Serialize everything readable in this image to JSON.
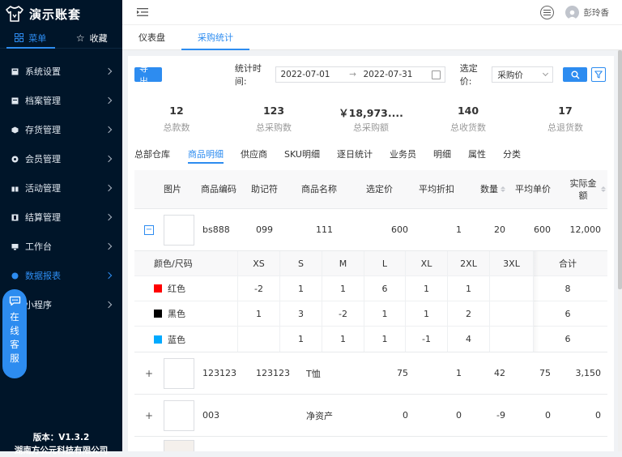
{
  "app": {
    "title": "演示账套",
    "version": "版本：V1.3.2",
    "company": "湖南方公元科技有限公司"
  },
  "side_tabs": [
    {
      "label": "菜单",
      "icon": "grid-icon"
    },
    {
      "label": "收藏",
      "icon": "star-icon"
    }
  ],
  "menu": [
    {
      "label": "系统设置"
    },
    {
      "label": "档案管理"
    },
    {
      "label": "存货管理"
    },
    {
      "label": "会员管理"
    },
    {
      "label": "活动管理"
    },
    {
      "label": "结算管理"
    },
    {
      "label": "工作台"
    },
    {
      "label": "数据报表",
      "active": true
    },
    {
      "label": "小程序"
    }
  ],
  "chat": {
    "chars": [
      "在",
      "线",
      "客",
      "服"
    ]
  },
  "user": {
    "name": "彭玲香"
  },
  "page_tabs": [
    {
      "label": "仪表盘"
    },
    {
      "label": "采购统计",
      "active": true
    }
  ],
  "filter": {
    "export_label": "导出",
    "time_label": "统计时间:",
    "start_date": "2022-07-01",
    "end_date": "2022-07-31",
    "price_label": "选定价:",
    "price_value": "采购价"
  },
  "stats": [
    {
      "value": "12",
      "label": "总款数"
    },
    {
      "value": "123",
      "label": "总采购数"
    },
    {
      "value": "￥18,973....",
      "label": "总采购额"
    },
    {
      "value": "140",
      "label": "总收货数"
    },
    {
      "value": "17",
      "label": "总退货数"
    }
  ],
  "sub_tabs": [
    "总部仓库",
    "商品明细",
    "供应商",
    "SKU明细",
    "逐日统计",
    "业务员",
    "明细",
    "属性",
    "分类"
  ],
  "table": {
    "headers": [
      "图片",
      "商品编码",
      "助记符",
      "商品名称",
      "选定价",
      "平均折扣",
      "数量",
      "平均单价",
      "实际金额"
    ],
    "rows": [
      {
        "expander": "−",
        "code": "bs888",
        "mnemonic": "099",
        "name": "111",
        "price": "600",
        "discount": "1",
        "qty": "20",
        "avg": "600",
        "amount": "12,000"
      },
      {
        "expander": "+",
        "code": "123123",
        "mnemonic": "123123",
        "name": "T恤",
        "price": "75",
        "discount": "1",
        "qty": "42",
        "avg": "75",
        "amount": "3,150"
      },
      {
        "expander": "+",
        "code": "003",
        "mnemonic": "",
        "name": "净资产",
        "price": "0",
        "discount": "0",
        "qty": "-9",
        "avg": "0",
        "amount": "0"
      }
    ],
    "detail": {
      "headers": [
        "颜色/尺码",
        "XS",
        "S",
        "M",
        "L",
        "XL",
        "2XL",
        "3XL",
        "合计"
      ],
      "rows": [
        {
          "color": "红色",
          "swatch": "#ff0000",
          "cells": [
            "-2",
            "1",
            "1",
            "6",
            "1",
            "1",
            "",
            "8"
          ]
        },
        {
          "color": "黑色",
          "swatch": "#000000",
          "cells": [
            "1",
            "3",
            "-2",
            "1",
            "1",
            "2",
            "",
            "6"
          ]
        },
        {
          "color": "蓝色",
          "swatch": "#00aaff",
          "cells": [
            "",
            "1",
            "1",
            "1",
            "-1",
            "4",
            "",
            "6"
          ]
        }
      ]
    }
  },
  "colors": {
    "accent": "#2d8cf0",
    "sidebar": "#001529"
  }
}
